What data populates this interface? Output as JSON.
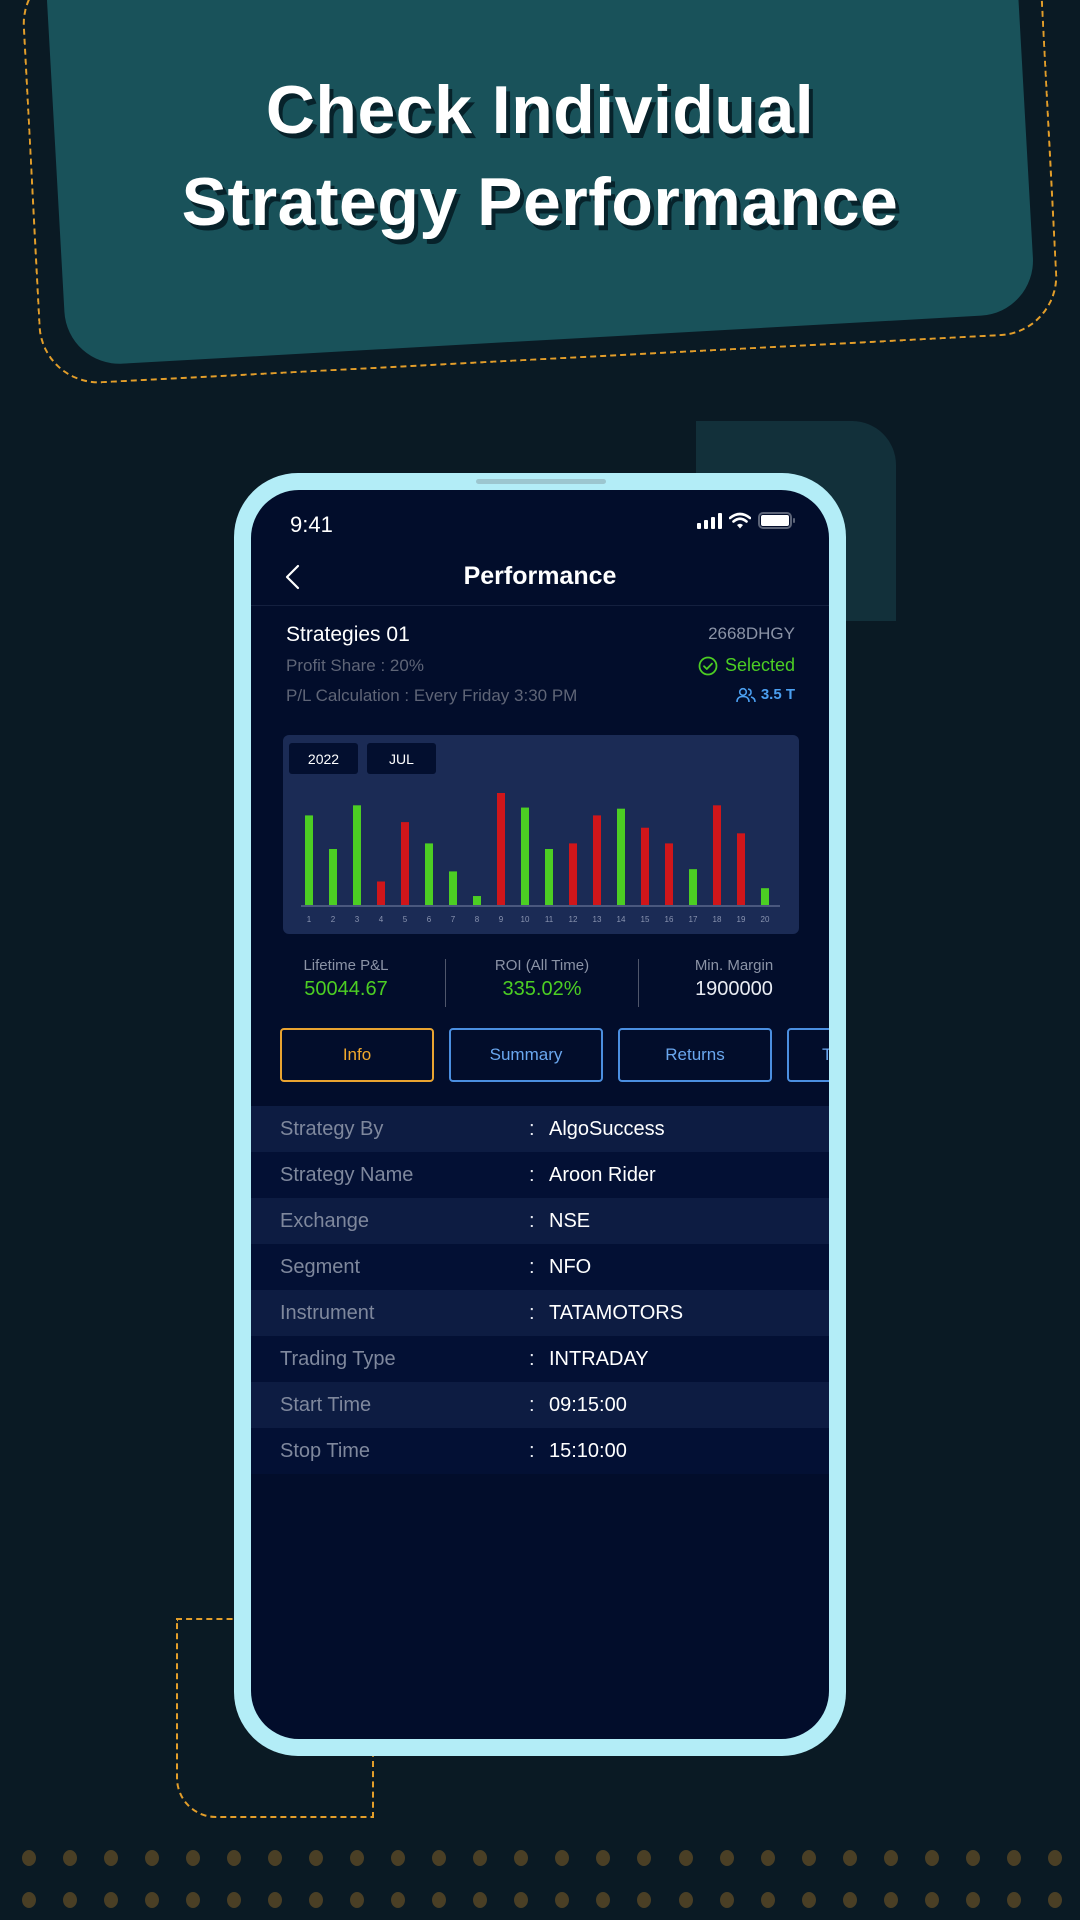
{
  "headline": {
    "line1": "Check Individual",
    "line2": "Strategy Performance"
  },
  "status_bar": {
    "time": "9:41",
    "icons": [
      "signal-icon",
      "wifi-icon",
      "battery-icon"
    ]
  },
  "navbar": {
    "back_icon": "chevron-left-icon",
    "title": "Performance"
  },
  "strategy": {
    "name": "Strategies 01",
    "code": "2668DHGY",
    "profit_share": "Profit Share : 20%",
    "pl_calculation": "P/L Calculation : Every Friday 3:30 PM",
    "status": "Selected",
    "status_icon": "check-circle-icon",
    "subscribers": "3.5 T",
    "subscribers_icon": "users-icon"
  },
  "filters": {
    "year": "2022",
    "month": "JUL"
  },
  "colors": {
    "profit": "#4cce23",
    "loss": "#d0161a",
    "active_tab": "#f0a82c",
    "tab": "#6aa7ef"
  },
  "chart_data": {
    "type": "bar",
    "title": "",
    "xlabel": "",
    "ylabel": "",
    "categories": [
      "1",
      "2",
      "3",
      "4",
      "5",
      "6",
      "7",
      "8",
      "9",
      "10",
      "11",
      "12",
      "13",
      "14",
      "15",
      "16",
      "17",
      "18",
      "19",
      "20"
    ],
    "values": [
      80,
      50,
      89,
      21,
      74,
      55,
      30,
      8,
      100,
      87,
      50,
      55,
      80,
      86,
      69,
      55,
      32,
      89,
      64,
      15
    ],
    "series_sign": [
      "profit",
      "profit",
      "profit",
      "loss",
      "loss",
      "profit",
      "profit",
      "profit",
      "loss",
      "profit",
      "profit",
      "loss",
      "loss",
      "profit",
      "loss",
      "loss",
      "profit",
      "loss",
      "loss",
      "profit"
    ],
    "ylim": [
      0,
      100
    ],
    "grid": false,
    "legend": "none"
  },
  "metrics": [
    {
      "label": "Lifetime P&L",
      "value": "50044.67"
    },
    {
      "label": "ROI (All Time)",
      "value": "335.02%"
    },
    {
      "label": "Min. Margin",
      "value": "1900000"
    }
  ],
  "tabs": [
    {
      "label": "Info",
      "active": true
    },
    {
      "label": "Summary",
      "active": false
    },
    {
      "label": "Returns",
      "active": false
    },
    {
      "label": "T",
      "active": false
    }
  ],
  "info": [
    {
      "key": "Strategy By",
      "value": "AlgoSuccess"
    },
    {
      "key": "Strategy Name",
      "value": "Aroon Rider"
    },
    {
      "key": "Exchange",
      "value": "NSE"
    },
    {
      "key": "Segment",
      "value": "NFO"
    },
    {
      "key": "Instrument",
      "value": "TATAMOTORS"
    },
    {
      "key": "Trading Type",
      "value": "INTRADAY"
    },
    {
      "key": "Start Time",
      "value": "09:15:00"
    },
    {
      "key": "Stop Time",
      "value": "15:10:00"
    }
  ],
  "separator": ":"
}
